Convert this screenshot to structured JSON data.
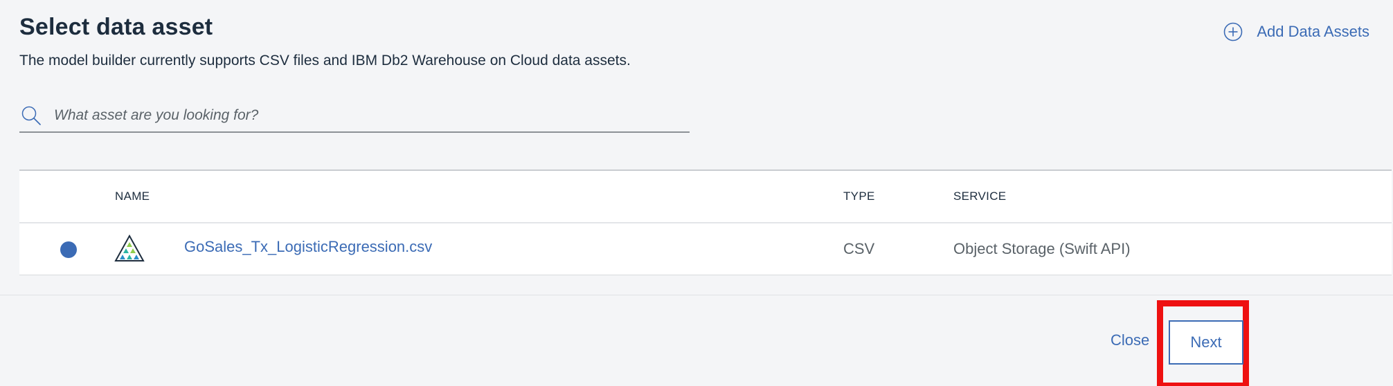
{
  "header": {
    "title": "Select data asset",
    "subtitle": "The model builder currently supports CSV files and IBM Db2 Warehouse on Cloud data assets.",
    "add_assets_label": "Add Data Assets",
    "add_assets_icon": "plus-circle-icon"
  },
  "search": {
    "placeholder": "What asset are you looking for?",
    "value": "",
    "icon": "search-icon"
  },
  "table": {
    "columns": [
      "NAME",
      "TYPE",
      "SERVICE"
    ],
    "rows": [
      {
        "selected": true,
        "icon": "dataset-triangle-icon",
        "name": "GoSales_Tx_LogisticRegression.csv",
        "type": "CSV",
        "service": "Object Storage (Swift API)"
      }
    ]
  },
  "footer": {
    "close_label": "Close",
    "next_label": "Next"
  },
  "colors": {
    "accent": "#3b6bb5",
    "text_dark": "#1d2d3e",
    "text_muted": "#5a6268",
    "background": "#f4f5f7",
    "highlight": "#ee1111"
  }
}
